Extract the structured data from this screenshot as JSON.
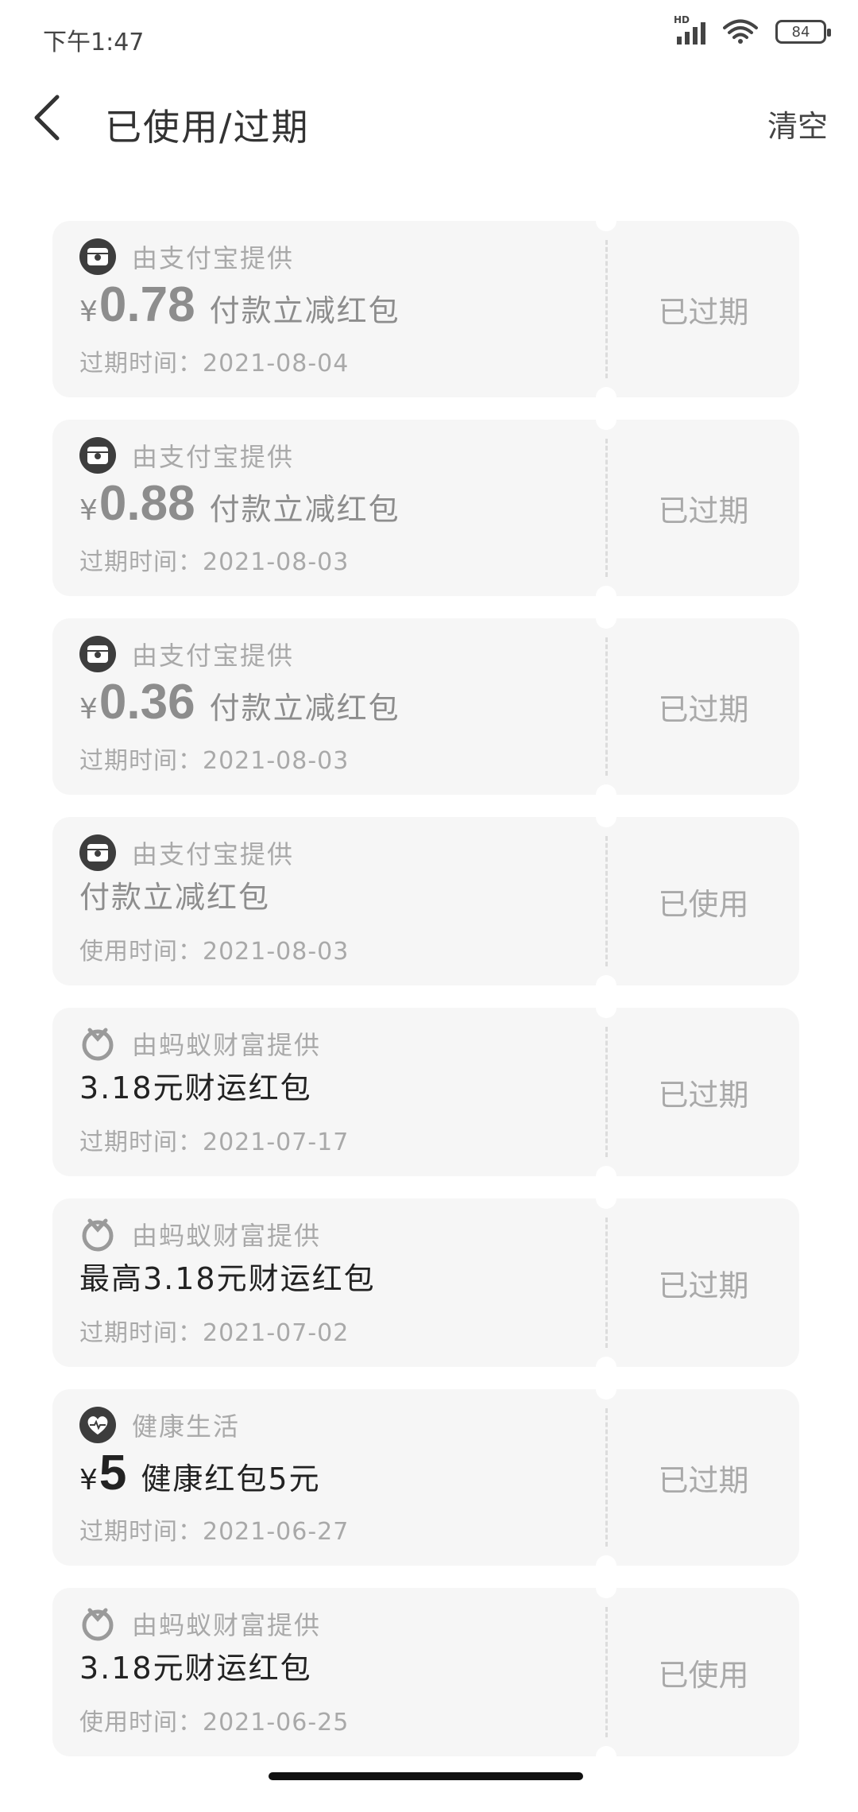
{
  "status_bar": {
    "time": "下午1:47",
    "network": "HD",
    "battery": "84"
  },
  "header": {
    "title": "已使用/过期",
    "clear_label": "清空"
  },
  "coupons": [
    {
      "icon": "alipay-icon",
      "provider": "由支付宝提供",
      "currency": "¥",
      "amount": "0.78",
      "name": "付款立减红包",
      "date_label": "过期时间：",
      "date": "2021-08-04",
      "status": "已过期"
    },
    {
      "icon": "alipay-icon",
      "provider": "由支付宝提供",
      "currency": "¥",
      "amount": "0.88",
      "name": "付款立减红包",
      "date_label": "过期时间：",
      "date": "2021-08-03",
      "status": "已过期"
    },
    {
      "icon": "alipay-icon",
      "provider": "由支付宝提供",
      "currency": "¥",
      "amount": "0.36",
      "name": "付款立减红包",
      "date_label": "过期时间：",
      "date": "2021-08-03",
      "status": "已过期"
    },
    {
      "icon": "alipay-icon",
      "provider": "由支付宝提供",
      "name": "付款立减红包",
      "date_label": "使用时间：",
      "date": "2021-08-03",
      "status": "已使用"
    },
    {
      "icon": "ant-fortune-icon",
      "provider": "由蚂蚁财富提供",
      "name": "3.18元财运红包",
      "date_label": "过期时间：",
      "date": "2021-07-17",
      "status": "已过期"
    },
    {
      "icon": "ant-fortune-icon",
      "provider": "由蚂蚁财富提供",
      "name": "最高3.18元财运红包",
      "date_label": "过期时间：",
      "date": "2021-07-02",
      "status": "已过期"
    },
    {
      "icon": "health-icon",
      "provider": "健康生活",
      "currency": "¥",
      "amount": "5",
      "name": "健康红包5元",
      "date_label": "过期时间：",
      "date": "2021-06-27",
      "status": "已过期"
    },
    {
      "icon": "ant-fortune-icon",
      "provider": "由蚂蚁财富提供",
      "name": "3.18元财运红包",
      "date_label": "使用时间：",
      "date": "2021-06-25",
      "status": "已使用"
    }
  ]
}
